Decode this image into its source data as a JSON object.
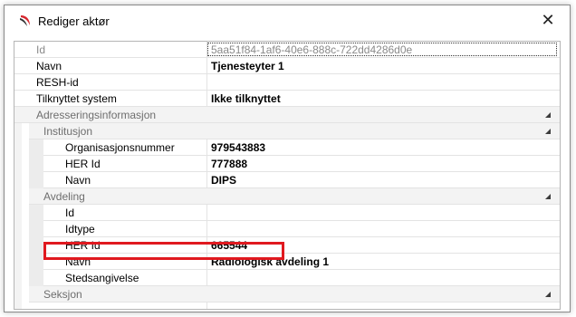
{
  "window": {
    "title": "Rediger aktør",
    "close_glyph": "✕"
  },
  "rows": {
    "id": {
      "label": "Id",
      "value": "5aa51f84-1af6-40e6-888c-722dd4286d0e"
    },
    "navn": {
      "label": "Navn",
      "value": "Tjenesteyter 1"
    },
    "resh": {
      "label": "RESH-id",
      "value": ""
    },
    "system": {
      "label": "Tilknyttet system",
      "value": "Ikke tilknyttet"
    },
    "adresse": {
      "label": "Adresseringsinformasjon"
    },
    "institusjon": {
      "label": "Institusjon"
    },
    "orgnr": {
      "label": "Organisasjonsnummer",
      "value": "979543883"
    },
    "inst_her": {
      "label": "HER Id",
      "value": "777888"
    },
    "inst_navn": {
      "label": "Navn",
      "value": "DIPS"
    },
    "avdeling": {
      "label": "Avdeling"
    },
    "avd_id": {
      "label": "Id",
      "value": ""
    },
    "avd_idtype": {
      "label": "Idtype",
      "value": ""
    },
    "avd_her": {
      "label": "HER Id",
      "value": "665544"
    },
    "avd_navn": {
      "label": "Navn",
      "value": "Radiologisk avdeling 1"
    },
    "avd_sted": {
      "label": "Stedsangivelse",
      "value": ""
    },
    "seksjon": {
      "label": "Seksjon"
    }
  },
  "colors": {
    "highlight": "#e0191f",
    "app_icon": "#d6262d"
  }
}
